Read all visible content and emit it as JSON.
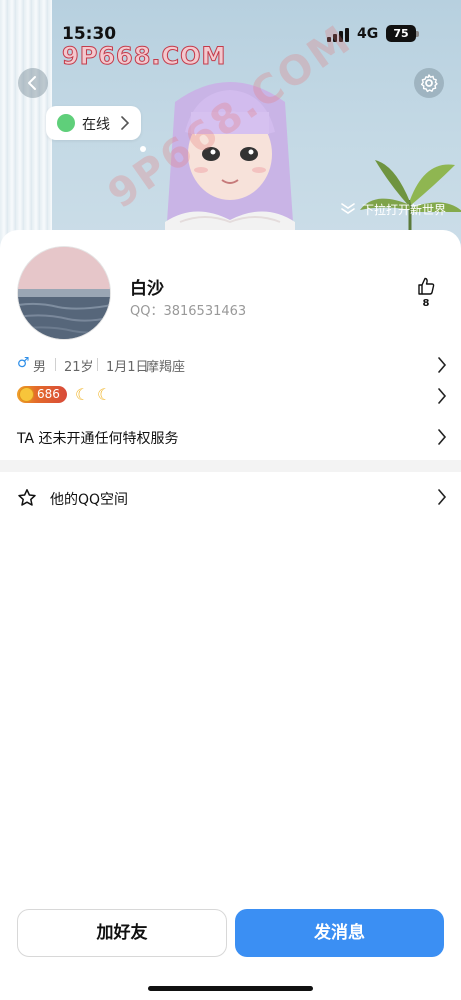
{
  "status_bar": {
    "time": "15:30",
    "network": "4G",
    "battery": "75"
  },
  "watermark": {
    "top_text": "9P668.COM",
    "diagonal_text": "9P668.COM"
  },
  "hero": {
    "online_label": "在线",
    "hint_text": "下拉打开新世界"
  },
  "profile": {
    "nickname": "白沙",
    "qq_label": "QQ：3816531463",
    "likes": "8",
    "gender": "男",
    "age": "21岁",
    "birthday": "1月1日",
    "zodiac": "摩羯座",
    "level": "686",
    "privilege_text": "TA 还未开通任何特权服务"
  },
  "links": {
    "qzone": "他的QQ空间"
  },
  "actions": {
    "add_friend": "加好友",
    "send_message": "发消息"
  },
  "colors": {
    "accent": "#3b8ff3",
    "online": "#5fcf7a",
    "gender": "#2f8fe8",
    "level_badge": "#e36a2a"
  }
}
